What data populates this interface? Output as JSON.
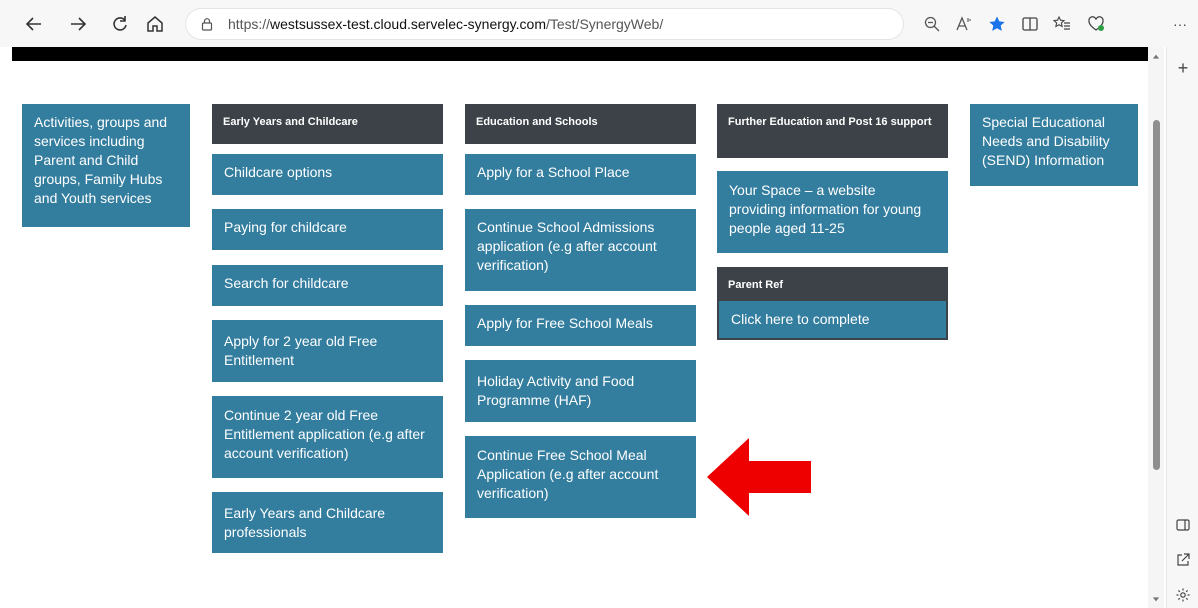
{
  "browser": {
    "url_prefix": "https://",
    "url_host": "westsussex-test.cloud.servelec-synergy.com",
    "url_path": "/Test/SynergyWeb/",
    "more_label": "···",
    "new_tab_label": "+"
  },
  "tiles": {
    "activities": "Activities, groups and services including Parent and Child groups, Family Hubs and Youth services",
    "send": "Special Educational Needs and Disability (SEND) Information"
  },
  "early_years": {
    "header": "Early Years and Childcare",
    "items": [
      "Childcare options",
      "Paying for childcare",
      "Search for childcare",
      "Apply for 2 year old Free Entitlement",
      "Continue 2 year old Free Entitlement application (e.g after account verification)",
      "Early Years and Childcare professionals"
    ]
  },
  "education": {
    "header": "Education and Schools",
    "items": [
      "Apply for a School Place",
      "Continue School Admissions application (e.g after account verification)",
      "Apply for Free School Meals",
      "Holiday Activity and Food Programme (HAF)",
      "Continue Free School Meal Application (e.g after account verification)"
    ]
  },
  "further_education": {
    "header": "Further Education and Post 16 support",
    "items": [
      "Your Space – a website providing information for young people aged 11-25"
    ]
  },
  "parent_ref": {
    "header": "Parent Ref",
    "link": "Click here to complete"
  },
  "colors": {
    "tile": "#337d9e",
    "header": "#3c4248",
    "annotation_arrow": "#ee0000"
  }
}
